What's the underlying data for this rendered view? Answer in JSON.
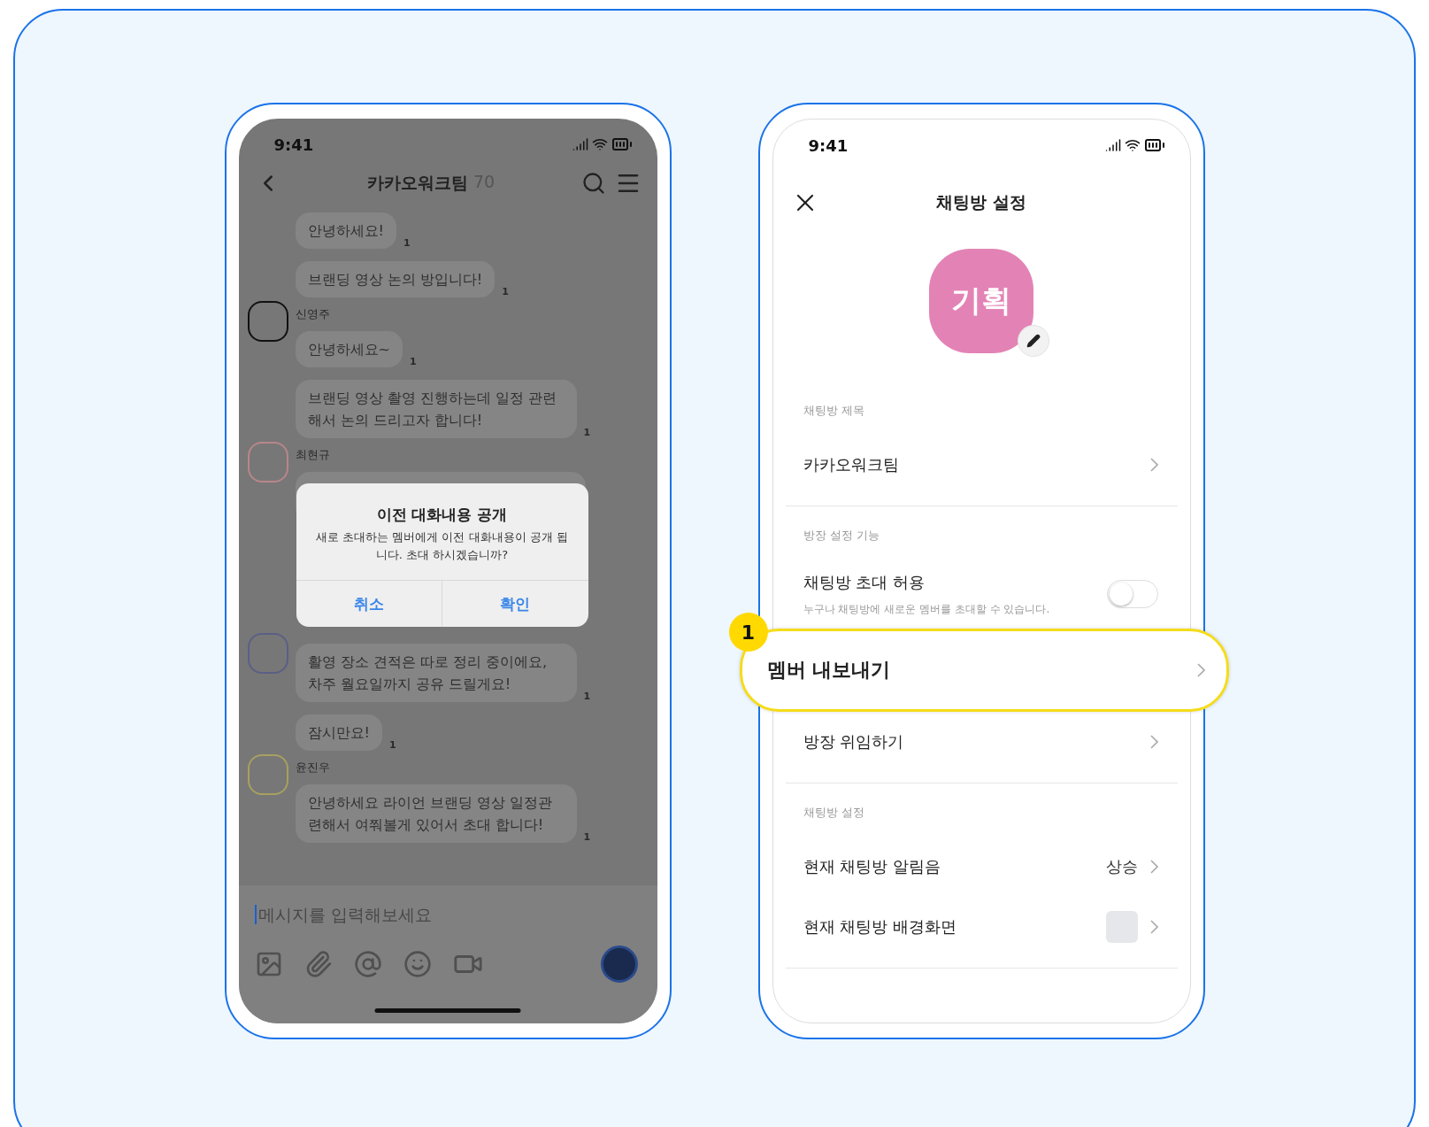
{
  "chat_screen": {
    "status_time": "9:41",
    "title": "카카오워크팀",
    "member_count": "70",
    "groups": [
      {
        "bubbles": [
          {
            "text": "안녕하세요!",
            "unread": "1"
          },
          {
            "text": "브랜딩 영상 논의 방입니다!",
            "unread": "1"
          }
        ]
      },
      {
        "name": "신영주",
        "color": "#111111",
        "bubbles": [
          {
            "text": "안녕하세요~",
            "unread": "1"
          },
          {
            "text": "브랜딩 영상 촬영 진행하는데 일정 관련 해서 논의 드리고자 합니다!",
            "unread": "1"
          }
        ]
      },
      {
        "name": "최현규",
        "color": "#b8868a"
      },
      {
        "color": "#5a5f86",
        "bubbles": [
          {
            "text": "활영 장소 견적은 따로 정리 중이에요, 차주 월요일까지 공유 드릴게요!",
            "unread": "1"
          },
          {
            "text": "잠시만요!",
            "unread": "1"
          }
        ]
      },
      {
        "name": "윤진우",
        "color": "#a8a060",
        "bubbles": [
          {
            "text": "안녕하세요 라이언 브랜딩 영상 일정관 련해서 여쭤볼게 있어서 초대 합니다!",
            "unread": "1"
          }
        ]
      }
    ],
    "input": {
      "placeholder": "메시지를 입력해보세요"
    },
    "dialog": {
      "title": "이전 대화내용 공개",
      "message": "새로 초대하는 멤버에게 이전 대화내용이 공개 됩니다. 초대 하시겠습니까?",
      "buttons": [
        "취소",
        "확인"
      ]
    }
  },
  "settings_screen": {
    "status_time": "9:41",
    "title": "채팅방 설정",
    "room_icon": {
      "text": "기획",
      "color": "#e383b5"
    },
    "sections": [
      {
        "label": "채팅방 제목",
        "rows": [
          {
            "kind": "link",
            "label": "카카오워크팀"
          }
        ]
      },
      {
        "label": "방장 설정 기능",
        "rows": [
          {
            "kind": "toggle",
            "label": "채팅방 초대 허용",
            "description": "누구나 채팅방에 새로운 멤버를 초대할 수 있습니다.",
            "on": false
          },
          {
            "kind": "link",
            "label": "멤버 내보내기",
            "callout": "1"
          },
          {
            "kind": "link",
            "label": "방장 위임하기"
          }
        ]
      },
      {
        "label": "채팅방 설정",
        "rows": [
          {
            "kind": "value",
            "label": "현재 채팅방 알림음",
            "value": "상승"
          },
          {
            "kind": "swatch",
            "label": "현재 채팅방 배경화면",
            "color": "#e6e7ea"
          }
        ]
      }
    ]
  }
}
